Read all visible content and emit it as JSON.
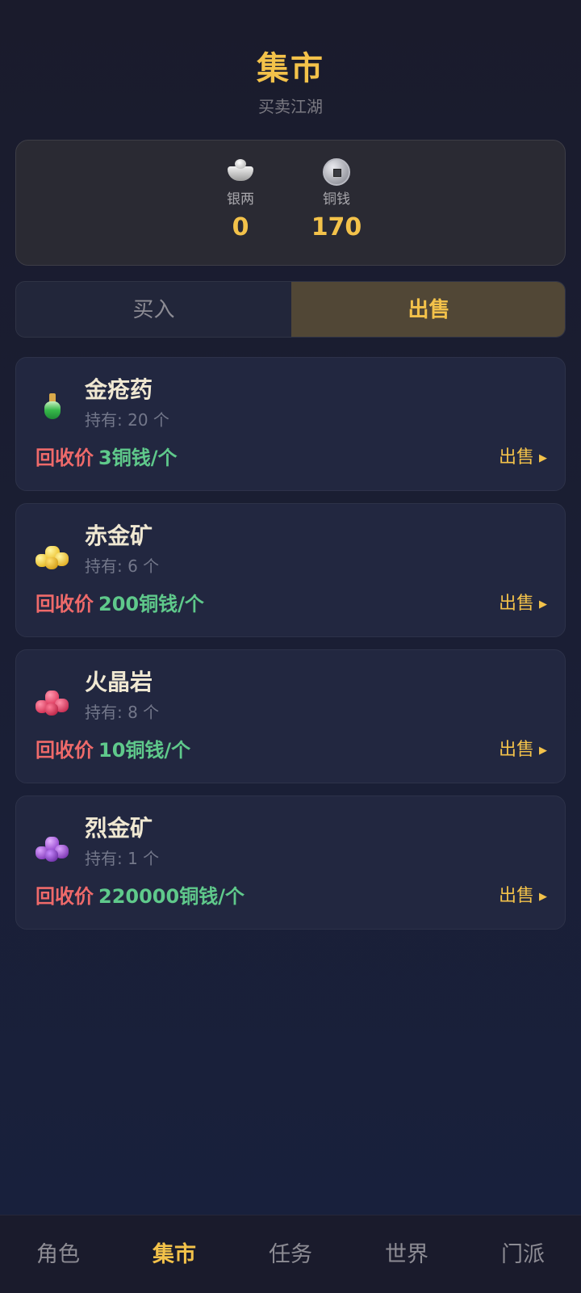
{
  "header": {
    "title": "集市",
    "subtitle": "买卖江湖"
  },
  "wallet": {
    "silver": {
      "label": "银两",
      "value": "0",
      "icon": "silver-ingot-icon"
    },
    "copper": {
      "label": "铜钱",
      "value": "170",
      "icon": "copper-coin-icon"
    }
  },
  "tabs": {
    "buy": "买入",
    "sell": "出售",
    "active": "sell"
  },
  "items": [
    {
      "name": "金疮药",
      "hold": "持有: 20 个",
      "price_label": "回收价",
      "price": "3铜钱/个",
      "sell": "出售",
      "icon": "green-potion-icon"
    },
    {
      "name": "赤金矿",
      "hold": "持有: 6 个",
      "price_label": "回收价",
      "price": "200铜钱/个",
      "sell": "出售",
      "icon": "gold-ore-icon"
    },
    {
      "name": "火晶岩",
      "hold": "持有: 8 个",
      "price_label": "回收价",
      "price": "10铜钱/个",
      "sell": "出售",
      "icon": "red-crystal-icon"
    },
    {
      "name": "烈金矿",
      "hold": "持有: 1 个",
      "price_label": "回收价",
      "price": "220000铜钱/个",
      "sell": "出售",
      "icon": "purple-ore-icon"
    }
  ],
  "nav": {
    "items": [
      "角色",
      "集市",
      "任务",
      "世界",
      "门派"
    ],
    "active": "集市"
  },
  "colors": {
    "accent": "#f3c24a",
    "price_label": "#ef6a6a",
    "price_value": "#5fc98b",
    "background": "#1a1f36"
  }
}
